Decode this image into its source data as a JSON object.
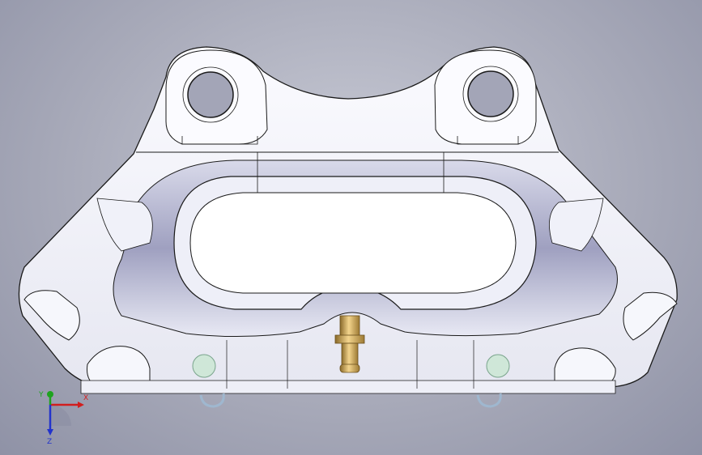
{
  "viewport": {
    "background_top": "#c9cbd6",
    "background_bottom": "#8f92a6"
  },
  "model": {
    "body_color": "#f4f5fb",
    "shade_color": "#b9bad0",
    "edge_color": "#1a1a1a",
    "bleed_nipple_color": "#c9a15a",
    "locator_pin_color": "#cfe7d8",
    "clip_color": "#bfd4e8"
  },
  "triad": {
    "x_label": "X",
    "y_label": "Y",
    "z_label": "Z",
    "x_color": "#d11e1e",
    "y_color": "#1ea31e",
    "z_color": "#2233cc"
  }
}
